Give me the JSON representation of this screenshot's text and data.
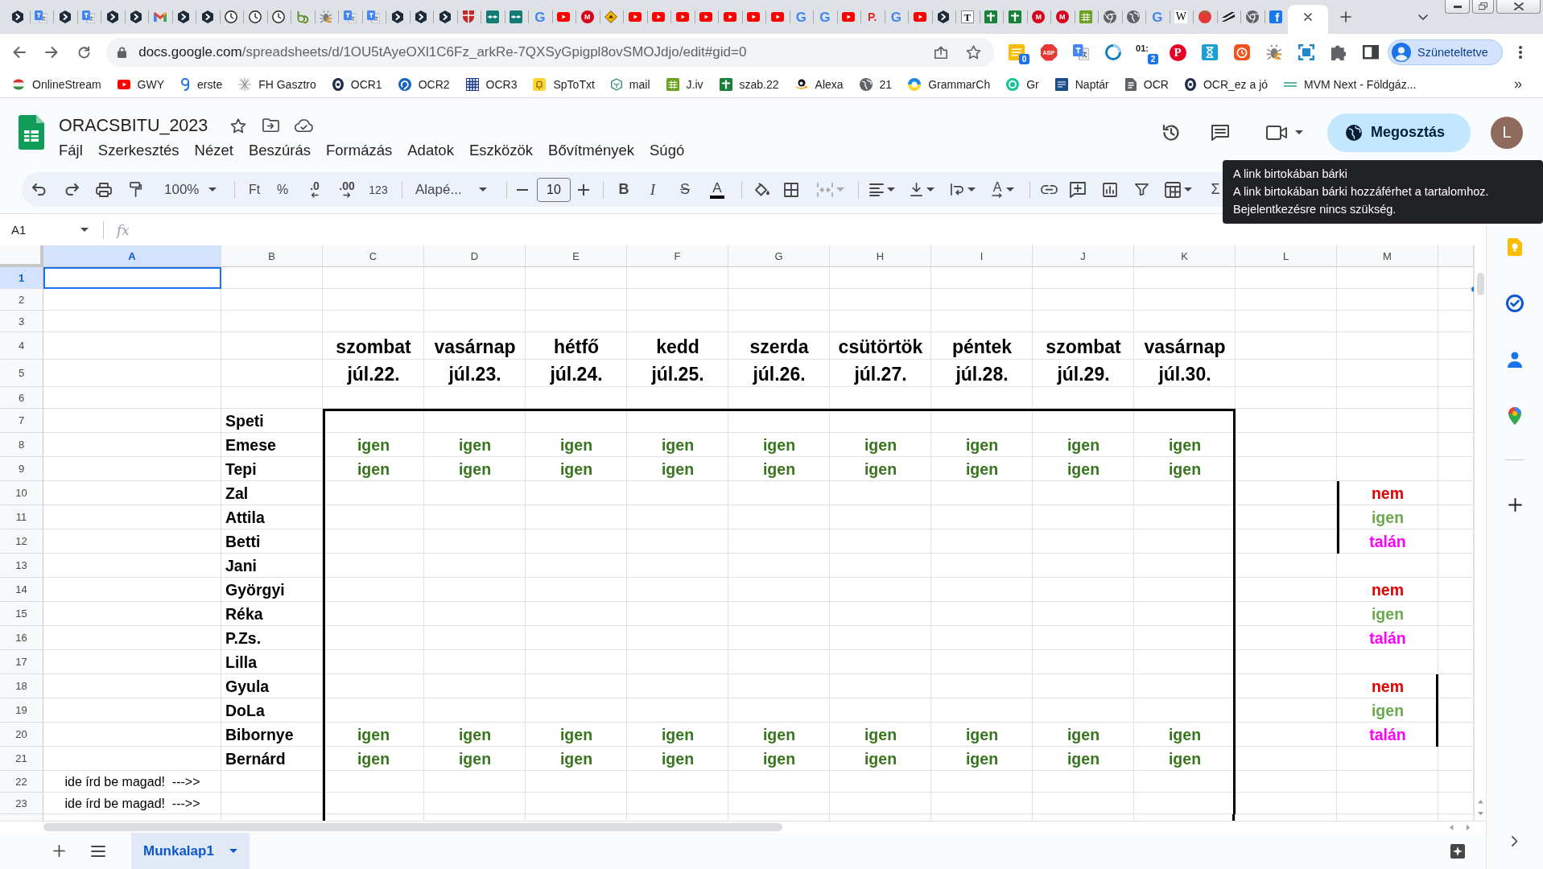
{
  "browser": {
    "tabs": [
      {
        "kind": "hex",
        "selected": false
      },
      {
        "kind": "translate",
        "selected": false
      },
      {
        "kind": "hex",
        "selected": false
      },
      {
        "kind": "translate",
        "selected": false
      },
      {
        "kind": "hex",
        "selected": false
      },
      {
        "kind": "hex",
        "selected": false
      },
      {
        "kind": "mail",
        "selected": false
      },
      {
        "kind": "hex",
        "selected": false
      },
      {
        "kind": "hex",
        "selected": false
      },
      {
        "kind": "clock",
        "selected": false
      },
      {
        "kind": "clock",
        "selected": false
      },
      {
        "kind": "clock",
        "selected": false
      },
      {
        "kind": "loop",
        "selected": false
      },
      {
        "kind": "bug",
        "selected": false
      },
      {
        "kind": "translate",
        "selected": false
      },
      {
        "kind": "translate",
        "selected": false
      },
      {
        "kind": "hex",
        "selected": false
      },
      {
        "kind": "hex",
        "selected": false
      },
      {
        "kind": "hex",
        "selected": false
      },
      {
        "kind": "crest",
        "selected": false
      },
      {
        "kind": "chain",
        "selected": false
      },
      {
        "kind": "chain",
        "selected": false
      },
      {
        "kind": "google",
        "glyph": "G",
        "selected": false
      },
      {
        "kind": "video",
        "selected": false
      },
      {
        "kind": "mega",
        "glyph": "M",
        "selected": false
      },
      {
        "kind": "diamond",
        "selected": false
      },
      {
        "kind": "video",
        "selected": false
      },
      {
        "kind": "video",
        "selected": false
      },
      {
        "kind": "video",
        "selected": false
      },
      {
        "kind": "video",
        "selected": false
      },
      {
        "kind": "video",
        "selected": false
      },
      {
        "kind": "video",
        "selected": false
      },
      {
        "kind": "video",
        "selected": false
      },
      {
        "kind": "google",
        "glyph": "G",
        "selected": false
      },
      {
        "kind": "google",
        "glyph": "G",
        "selected": false
      },
      {
        "kind": "video",
        "selected": false
      },
      {
        "kind": "pletter",
        "glyph": "P.",
        "selected": false
      },
      {
        "kind": "google",
        "glyph": "G",
        "selected": false
      },
      {
        "kind": "video",
        "selected": false
      },
      {
        "kind": "hex",
        "selected": false
      },
      {
        "kind": "tletter",
        "glyph": "T",
        "selected": false
      },
      {
        "kind": "plus",
        "selected": false
      },
      {
        "kind": "plus",
        "selected": false
      },
      {
        "kind": "mega",
        "glyph": "M",
        "selected": false
      },
      {
        "kind": "mega",
        "glyph": "M",
        "selected": false
      },
      {
        "kind": "sheet",
        "selected": false
      },
      {
        "kind": "wheel",
        "selected": false
      },
      {
        "kind": "globe",
        "selected": false
      },
      {
        "kind": "google",
        "glyph": "G",
        "selected": false
      },
      {
        "kind": "wiki",
        "glyph": "W",
        "selected": false
      },
      {
        "kind": "tomato",
        "selected": false
      },
      {
        "kind": "slash",
        "selected": false
      },
      {
        "kind": "wheel",
        "selected": false
      },
      {
        "kind": "fb",
        "glyph": "f",
        "selected": false
      },
      {
        "selected": true
      }
    ],
    "url": {
      "host": "docs.google.com",
      "path": "/spreadsheets/d/1OU5tAyeOXl1C6Fz_arkRe-7QXSyGpigpl8ovSMOJdjo/edit#gid=0"
    },
    "extensions": [
      {
        "kind": "note",
        "badge": "0"
      },
      {
        "kind": "abp",
        "glyph": "ABP"
      },
      {
        "kind": "translate"
      },
      {
        "kind": "ring"
      },
      {
        "kind": "timer",
        "glyph": "01:",
        "badge": "2"
      },
      {
        "kind": "pinterest",
        "glyph": "P"
      },
      {
        "kind": "hourglass"
      },
      {
        "kind": "alarm"
      },
      {
        "kind": "bug"
      },
      {
        "kind": "capture"
      },
      {
        "kind": "puzzle"
      },
      {
        "kind": "panel"
      }
    ],
    "profile": {
      "label": "Szüneteltetve"
    },
    "bookmarks": [
      {
        "kind": "flag",
        "label": "OnlineStream"
      },
      {
        "kind": "video",
        "label": "GWY"
      },
      {
        "kind": "pin",
        "label": "erste"
      },
      {
        "kind": "sparkle",
        "label": "FH Gasztro"
      },
      {
        "kind": "medal",
        "label": "OCR1"
      },
      {
        "kind": "swirl",
        "label": "OCR2"
      },
      {
        "kind": "grid",
        "label": "OCR3"
      },
      {
        "kind": "bell",
        "label": "SpToTxt"
      },
      {
        "kind": "hexline",
        "label": "mail"
      },
      {
        "kind": "sheet",
        "label": "J.iv"
      },
      {
        "kind": "plus",
        "label": "szab.22"
      },
      {
        "kind": "smile",
        "label": "Alexa"
      },
      {
        "kind": "globe",
        "label": "21"
      },
      {
        "kind": "halfring",
        "label": "GrammarCh"
      },
      {
        "kind": "hollowring",
        "label": "Gr"
      },
      {
        "kind": "calendar",
        "label": "Naptár"
      },
      {
        "kind": "doc",
        "label": "OCR"
      },
      {
        "kind": "medal",
        "label": "OCR_ez a jó"
      },
      {
        "kind": "waves",
        "label": "MVM Next - Földgáz..."
      }
    ],
    "bookmarks_more": "»"
  },
  "document": {
    "title": "ORACSBITU_2023",
    "menu": [
      "Fájl",
      "Szerkesztés",
      "Nézet",
      "Beszúrás",
      "Formázás",
      "Adatok",
      "Eszközök",
      "Bővítmények",
      "Súgó"
    ],
    "share_button": "Megosztás",
    "avatar": "L"
  },
  "toolbar": {
    "zoom": "100%",
    "currency": "Ft",
    "percent": "%",
    "decrease_decimals": ".0",
    "increase_decimals": ".00",
    "number_format": "123",
    "font": "Alapé...",
    "font_size": "10",
    "bold": "B",
    "italic": "I",
    "strikethrough": "S",
    "text_color": "A",
    "text_rotation": "A",
    "functions": "Σ"
  },
  "tooltip": {
    "title": "A link birtokában bárki",
    "lines": [
      "A link birtokában bárki hozzáférhet a tartalomhoz.",
      "Bejelentkezésre nincs szükség."
    ]
  },
  "formula_bar": {
    "name_box": "A1",
    "function_label": "fx"
  },
  "sheet": {
    "columns": [
      {
        "label": "A",
        "selected": true
      },
      {
        "label": "B",
        "selected": false
      },
      {
        "label": "C",
        "selected": false
      },
      {
        "label": "D",
        "selected": false
      },
      {
        "label": "E",
        "selected": false
      },
      {
        "label": "F",
        "selected": false
      },
      {
        "label": "G",
        "selected": false
      },
      {
        "label": "H",
        "selected": false
      },
      {
        "label": "I",
        "selected": false
      },
      {
        "label": "J",
        "selected": false
      },
      {
        "label": "K",
        "selected": false
      },
      {
        "label": "L",
        "selected": false
      },
      {
        "label": "M",
        "selected": false
      }
    ],
    "rows": [
      {
        "number": "1",
        "selected": true
      },
      {
        "number": "2",
        "selected": false
      },
      {
        "number": "3",
        "selected": false
      },
      {
        "number": "4",
        "selected": false,
        "cells": [
          null,
          null,
          {
            "kind": "day",
            "text": "szombat"
          },
          {
            "kind": "day",
            "text": "vasárnap"
          },
          {
            "kind": "day",
            "text": "hétfő"
          },
          {
            "kind": "day",
            "text": "kedd"
          },
          {
            "kind": "day",
            "text": "szerda"
          },
          {
            "kind": "day",
            "text": "csütörtök"
          },
          {
            "kind": "day",
            "text": "péntek"
          },
          {
            "kind": "day",
            "text": "szombat"
          },
          {
            "kind": "day",
            "text": "vasárnap"
          }
        ]
      },
      {
        "number": "5",
        "selected": false,
        "cells": [
          null,
          null,
          {
            "kind": "day",
            "text": "júl.22."
          },
          {
            "kind": "day",
            "text": "júl.23."
          },
          {
            "kind": "day",
            "text": "júl.24."
          },
          {
            "kind": "day",
            "text": "júl.25."
          },
          {
            "kind": "day",
            "text": "júl.26."
          },
          {
            "kind": "day",
            "text": "júl.27."
          },
          {
            "kind": "day",
            "text": "júl.28."
          },
          {
            "kind": "day",
            "text": "júl.29."
          },
          {
            "kind": "day",
            "text": "júl.30."
          }
        ]
      },
      {
        "number": "6",
        "selected": false
      },
      {
        "number": "7",
        "selected": false,
        "cells": [
          null,
          {
            "kind": "name",
            "text": "Speti"
          },
          {
            "border_left": true,
            "border_top": true
          },
          {
            "border_top": true
          },
          {
            "border_top": true
          },
          {
            "border_top": true
          },
          {
            "border_top": true
          },
          {
            "border_top": true
          },
          {
            "border_top": true
          },
          {
            "border_top": true
          },
          {
            "border_top": true,
            "border_right": true
          }
        ]
      },
      {
        "number": "8",
        "selected": false,
        "cells": [
          null,
          {
            "kind": "name",
            "text": "Emese"
          },
          {
            "kind": "answer",
            "text": "igen",
            "color": "#38761d",
            "border_left": true
          },
          {
            "kind": "answer",
            "text": "igen",
            "color": "#38761d"
          },
          {
            "kind": "answer",
            "text": "igen",
            "color": "#38761d"
          },
          {
            "kind": "answer",
            "text": "igen",
            "color": "#38761d"
          },
          {
            "kind": "answer",
            "text": "igen",
            "color": "#38761d"
          },
          {
            "kind": "answer",
            "text": "igen",
            "color": "#38761d"
          },
          {
            "kind": "answer",
            "text": "igen",
            "color": "#38761d"
          },
          {
            "kind": "answer",
            "text": "igen",
            "color": "#38761d"
          },
          {
            "kind": "answer",
            "text": "igen",
            "color": "#38761d",
            "border_right": true
          }
        ]
      },
      {
        "number": "9",
        "selected": false,
        "cells": [
          null,
          {
            "kind": "name",
            "text": "Tepi"
          },
          {
            "kind": "answer",
            "text": "igen",
            "color": "#38761d",
            "border_left": true
          },
          {
            "kind": "answer",
            "text": "igen",
            "color": "#38761d"
          },
          {
            "kind": "answer",
            "text": "igen",
            "color": "#38761d"
          },
          {
            "kind": "answer",
            "text": "igen",
            "color": "#38761d"
          },
          {
            "kind": "answer",
            "text": "igen",
            "color": "#38761d"
          },
          {
            "kind": "answer",
            "text": "igen",
            "color": "#38761d"
          },
          {
            "kind": "answer",
            "text": "igen",
            "color": "#38761d"
          },
          {
            "kind": "answer",
            "text": "igen",
            "color": "#38761d"
          },
          {
            "kind": "answer",
            "text": "igen",
            "color": "#38761d",
            "border_right": true
          }
        ]
      },
      {
        "number": "10",
        "selected": false,
        "cells": [
          null,
          {
            "kind": "name",
            "text": "Zal"
          },
          {
            "border_left": true
          },
          null,
          null,
          null,
          null,
          null,
          null,
          null,
          {
            "border_right": true
          },
          null,
          {
            "kind": "answer",
            "text": "nem",
            "color": "#e00000",
            "border_left": true
          }
        ]
      },
      {
        "number": "11",
        "selected": false,
        "cells": [
          null,
          {
            "kind": "name",
            "text": "Attila"
          },
          {
            "border_left": true
          },
          null,
          null,
          null,
          null,
          null,
          null,
          null,
          {
            "border_right": true
          },
          null,
          {
            "kind": "answer",
            "text": "igen",
            "color": "#6aa84f",
            "border_left": true
          }
        ]
      },
      {
        "number": "12",
        "selected": false,
        "cells": [
          null,
          {
            "kind": "name",
            "text": "Betti"
          },
          {
            "border_left": true
          },
          null,
          null,
          null,
          null,
          null,
          null,
          null,
          {
            "border_right": true
          },
          null,
          {
            "kind": "answer",
            "text": "talán",
            "color": "#ff00ff",
            "border_left": true
          }
        ]
      },
      {
        "number": "13",
        "selected": false,
        "cells": [
          null,
          {
            "kind": "name",
            "text": "Jani"
          },
          {
            "border_left": true
          },
          null,
          null,
          null,
          null,
          null,
          null,
          null,
          {
            "border_right": true
          }
        ]
      },
      {
        "number": "14",
        "selected": false,
        "cells": [
          null,
          {
            "kind": "name",
            "text": "Györgyi"
          },
          {
            "border_left": true
          },
          null,
          null,
          null,
          null,
          null,
          null,
          null,
          {
            "border_right": true
          },
          null,
          {
            "kind": "answer",
            "text": "nem",
            "color": "#e00000"
          }
        ]
      },
      {
        "number": "15",
        "selected": false,
        "cells": [
          null,
          {
            "kind": "name",
            "text": "Réka"
          },
          {
            "border_left": true
          },
          null,
          null,
          null,
          null,
          null,
          null,
          null,
          {
            "border_right": true
          },
          null,
          {
            "kind": "answer",
            "text": "igen",
            "color": "#6aa84f"
          }
        ]
      },
      {
        "number": "16",
        "selected": false,
        "cells": [
          null,
          {
            "kind": "name",
            "text": "P.Zs."
          },
          {
            "border_left": true
          },
          null,
          null,
          null,
          null,
          null,
          null,
          null,
          {
            "border_right": true
          },
          null,
          {
            "kind": "answer",
            "text": "talán",
            "color": "#ff00ff"
          }
        ]
      },
      {
        "number": "17",
        "selected": false,
        "cells": [
          null,
          {
            "kind": "name",
            "text": "Lilla"
          },
          {
            "border_left": true
          },
          null,
          null,
          null,
          null,
          null,
          null,
          null,
          {
            "border_right": true
          }
        ]
      },
      {
        "number": "18",
        "selected": false,
        "cells": [
          null,
          {
            "kind": "name",
            "text": "Gyula"
          },
          {
            "border_left": true
          },
          null,
          null,
          null,
          null,
          null,
          null,
          null,
          {
            "border_right": true
          },
          null,
          {
            "kind": "answer",
            "text": "nem",
            "color": "#e00000",
            "border_right": true
          }
        ]
      },
      {
        "number": "19",
        "selected": false,
        "cells": [
          null,
          {
            "kind": "name",
            "text": "DoLa"
          },
          {
            "border_left": true
          },
          null,
          null,
          null,
          null,
          null,
          null,
          null,
          {
            "border_right": true
          },
          null,
          {
            "kind": "answer",
            "text": "igen",
            "color": "#6aa84f",
            "border_right": true
          }
        ]
      },
      {
        "number": "20",
        "selected": false,
        "cells": [
          null,
          {
            "kind": "name",
            "text": "Bibornye"
          },
          {
            "kind": "answer",
            "text": "igen",
            "color": "#38761d",
            "border_left": true
          },
          {
            "kind": "answer",
            "text": "igen",
            "color": "#38761d"
          },
          {
            "kind": "answer",
            "text": "igen",
            "color": "#38761d"
          },
          {
            "kind": "answer",
            "text": "igen",
            "color": "#38761d"
          },
          {
            "kind": "answer",
            "text": "igen",
            "color": "#38761d"
          },
          {
            "kind": "answer",
            "text": "igen",
            "color": "#38761d"
          },
          {
            "kind": "answer",
            "text": "igen",
            "color": "#38761d"
          },
          {
            "kind": "answer",
            "text": "igen",
            "color": "#38761d"
          },
          {
            "kind": "answer",
            "text": "igen",
            "color": "#38761d",
            "border_right": true
          },
          null,
          {
            "kind": "answer",
            "text": "talán",
            "color": "#ff00ff",
            "border_right": true
          }
        ]
      },
      {
        "number": "21",
        "selected": false,
        "cells": [
          null,
          {
            "kind": "name",
            "text": "Bernárd"
          },
          {
            "kind": "answer",
            "text": "igen",
            "color": "#38761d",
            "border_left": true
          },
          {
            "kind": "answer",
            "text": "igen",
            "color": "#38761d"
          },
          {
            "kind": "answer",
            "text": "igen",
            "color": "#38761d"
          },
          {
            "kind": "answer",
            "text": "igen",
            "color": "#38761d"
          },
          {
            "kind": "answer",
            "text": "igen",
            "color": "#38761d"
          },
          {
            "kind": "answer",
            "text": "igen",
            "color": "#38761d"
          },
          {
            "kind": "answer",
            "text": "igen",
            "color": "#38761d"
          },
          {
            "kind": "answer",
            "text": "igen",
            "color": "#38761d"
          },
          {
            "kind": "answer",
            "text": "igen",
            "color": "#38761d",
            "border_right": true
          }
        ]
      },
      {
        "number": "22",
        "selected": false,
        "cells": [
          {
            "kind": "note",
            "text": "ide írd be magad!  --->>"
          },
          null,
          {
            "border_left": true
          },
          null,
          null,
          null,
          null,
          null,
          null,
          null,
          {
            "border_right": true
          }
        ]
      },
      {
        "number": "23",
        "selected": false,
        "cells": [
          {
            "kind": "note",
            "text": "ide írd be magad!  --->>"
          },
          null,
          {
            "border_left": true
          },
          null,
          null,
          null,
          null,
          null,
          null,
          null,
          {
            "border_right": true
          }
        ]
      }
    ]
  },
  "sheet_tabs": [
    {
      "label": "Munkalap1",
      "selected": true
    }
  ]
}
